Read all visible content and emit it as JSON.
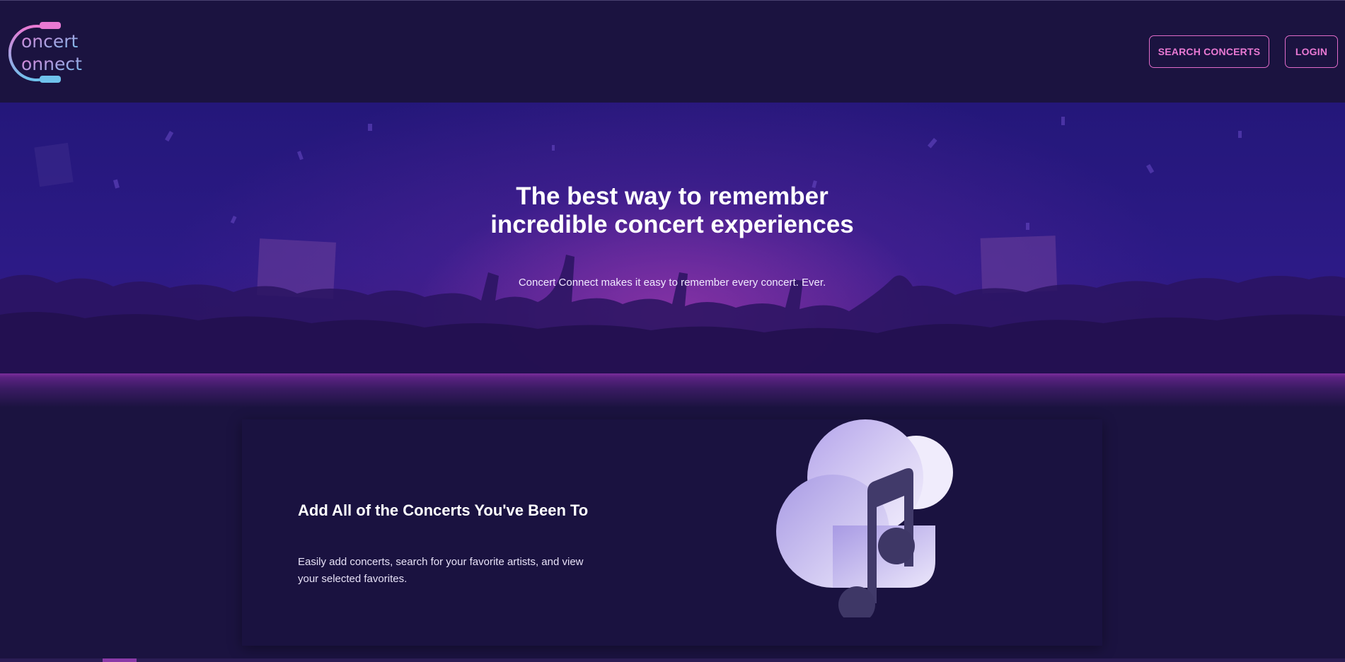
{
  "brand": {
    "line1": "oncert",
    "line2": "onnect",
    "pink": "#e979d3",
    "blue": "#6fc2ec"
  },
  "nav": {
    "search_label": "SEARCH CONCERTS",
    "login_label": "LOGIN",
    "accent": "#e979d3"
  },
  "hero": {
    "title": "The best way to remember incredible concert experiences",
    "subtitle": "Concert Connect makes it easy to remember every concert. Ever."
  },
  "feature": {
    "title": "Add All of the Concerts You've Been To",
    "description": "Easily add concerts, search for your favorite artists, and view your selected favorites.",
    "icon": "cloud-music-icon"
  },
  "colors": {
    "background": "#1b1340",
    "hero": "#2c1a86",
    "card": "#1a1240"
  }
}
